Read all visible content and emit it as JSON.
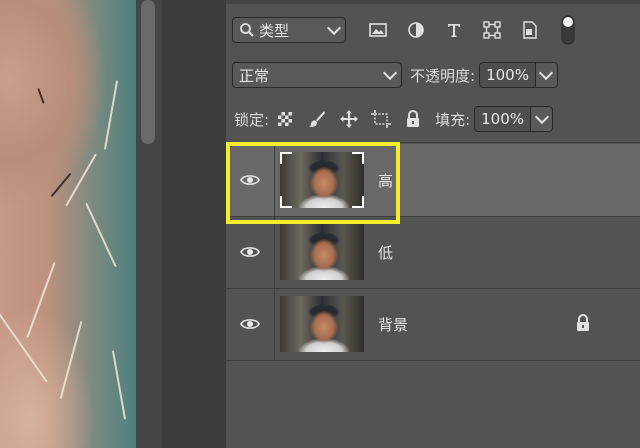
{
  "filter_bar": {
    "kind_label": "类型",
    "icons": [
      "image-filter-icon",
      "adjustment-filter-icon",
      "type-filter-icon",
      "shape-filter-icon",
      "smart-object-filter-icon",
      "filter-toggle-icon"
    ]
  },
  "blend": {
    "mode": "正常",
    "opacity_label": "不透明度:",
    "opacity_value": "100%"
  },
  "lock_row": {
    "lock_label": "锁定:",
    "fill_label": "填充:",
    "fill_value": "100%"
  },
  "layers": [
    {
      "name": "高",
      "selected": true,
      "visible": true,
      "locked": false
    },
    {
      "name": "低",
      "selected": false,
      "visible": true,
      "locked": false
    },
    {
      "name": "背景",
      "selected": false,
      "visible": true,
      "locked": true
    }
  ],
  "colors": {
    "panel_bg": "#535353",
    "selected_layer_bg": "#686868",
    "highlight": "#f4ee2c"
  }
}
